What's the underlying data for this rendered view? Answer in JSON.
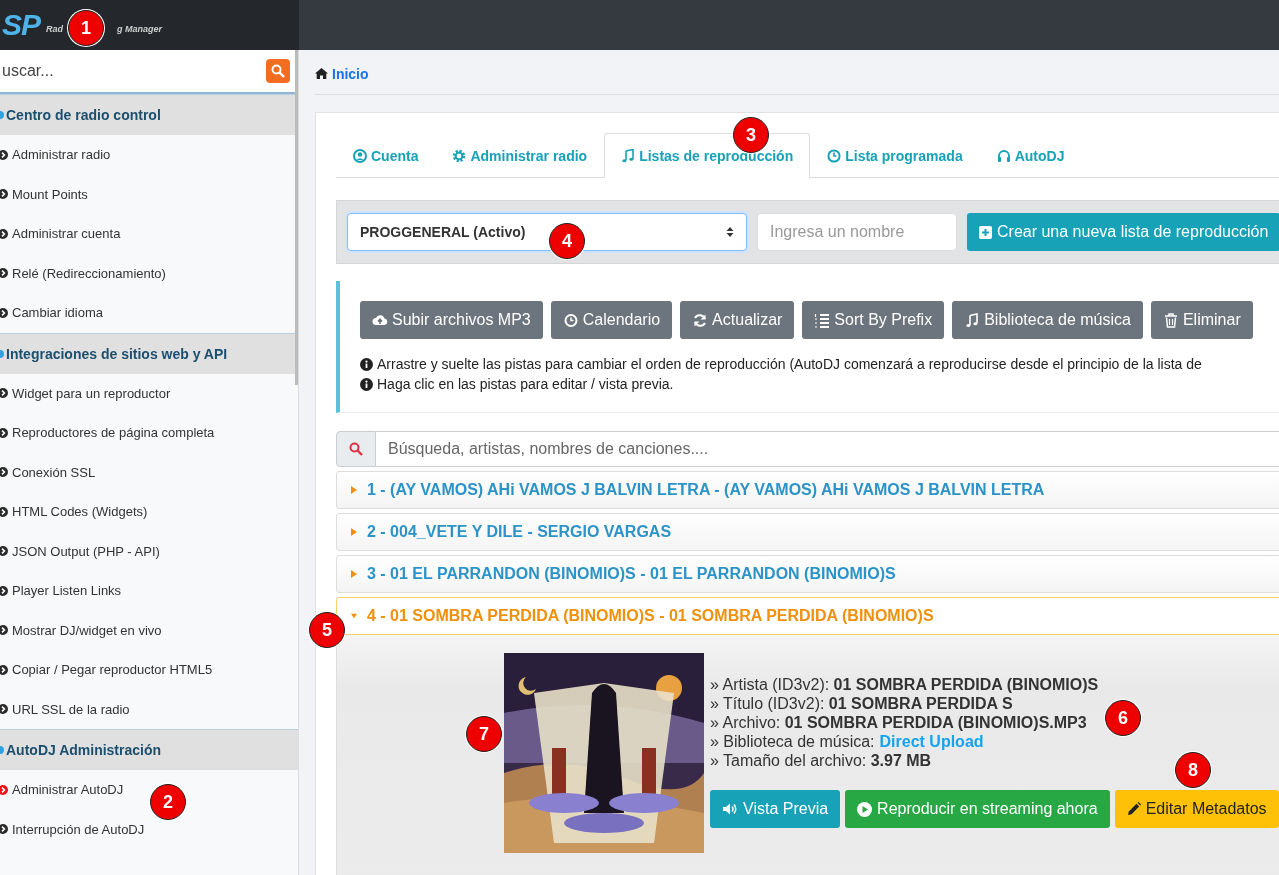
{
  "logo": {
    "mark": "SP",
    "subtitle_parts": [
      "Rad",
      "g Manager"
    ]
  },
  "sidebar": {
    "search": {
      "placeholder": "uscar..."
    },
    "sections": [
      {
        "title": "Centro de radio control",
        "items": [
          {
            "label": "Administrar radio",
            "selected": false
          },
          {
            "label": "Mount Points",
            "selected": false
          },
          {
            "label": "Administrar cuenta",
            "selected": false
          },
          {
            "label": "Relé (Redireccionamiento)",
            "selected": false
          },
          {
            "label": "Cambiar idioma",
            "selected": false
          }
        ]
      },
      {
        "title": "Integraciones de sitios web y API",
        "items": [
          {
            "label": "Widget para un reproductor",
            "selected": false
          },
          {
            "label": "Reproductores de página completa",
            "selected": false
          },
          {
            "label": "Conexión SSL",
            "selected": false
          },
          {
            "label": "HTML Codes (Widgets)",
            "selected": false
          },
          {
            "label": "JSON Output (PHP - API)",
            "selected": false
          },
          {
            "label": "Player Listen Links",
            "selected": false
          },
          {
            "label": "Mostrar DJ/widget en vivo",
            "selected": false
          },
          {
            "label": "Copiar / Pegar reproductor HTML5",
            "selected": false
          },
          {
            "label": "URL SSL de la radio",
            "selected": false
          }
        ]
      },
      {
        "title": "AutoDJ Administración",
        "items": [
          {
            "label": "Administrar AutoDJ",
            "selected": true
          },
          {
            "label": "Interrupción de AutoDJ",
            "selected": false
          }
        ]
      }
    ]
  },
  "breadcrumb": "Inicio",
  "tabs": [
    {
      "label": "Cuenta",
      "selected": false
    },
    {
      "label": "Administrar radio",
      "selected": false
    },
    {
      "label": "Listas de reproducción",
      "selected": true
    },
    {
      "label": "Lista programada",
      "selected": false
    },
    {
      "label": "AutoDJ",
      "selected": false
    }
  ],
  "playlist_select": {
    "value": "PROGGENERAL (Activo)"
  },
  "name_field": {
    "placeholder": "Ingresa un nombre"
  },
  "create_button": "Crear una nueva lista de reproducción",
  "toolbar": [
    "Subir archivos MP3",
    "Calendario",
    "Actualizar",
    "Sort By Prefix",
    "Biblioteca de música",
    "Eliminar"
  ],
  "notes": [
    "Arrastre y suelte las pistas para cambiar el orden de reproducción (AutoDJ comenzará a reproducirse desde el principio de la lista de",
    "Haga clic en las pistas para editar / vista previa."
  ],
  "track_search": {
    "placeholder": "Búsqueda, artistas, nombres de canciones...."
  },
  "tracks": [
    {
      "title": "1 - (AY VAMOS) AHi VAMOS J BALVIN LETRA - (AY VAMOS) AHi VAMOS J BALVIN LETRA",
      "expanded": false
    },
    {
      "title": "2 - 004_VETE Y DILE - SERGIO VARGAS",
      "expanded": false
    },
    {
      "title": "3 - 01 EL PARRANDON (BINOMIO)S - 01 EL PARRANDON (BINOMIO)S",
      "expanded": false
    },
    {
      "title": "4 - 01 SOMBRA PERDIDA (BINOMIO)S - 01 SOMBRA PERDIDA (BINOMIO)S",
      "expanded": true
    }
  ],
  "track_details": {
    "lines": [
      {
        "text": "» Artista (ID3v2): **01 SOMBRA PERDIDA (BINOMIO)S**"
      },
      {
        "text": "» Título (ID3v2): **01 SOMBRA PERDIDA S**"
      },
      {
        "text": "» Archivo: **01 SOMBRA PERDIDA (BINOMIO)S.MP3**"
      },
      {
        "text": "» Biblioteca de música:",
        "link": "Direct Upload"
      },
      {
        "text": "» Tamaño del archivo: **3.97 MB**"
      }
    ],
    "buttons": [
      {
        "label": "Vista Previa",
        "kind": "preview"
      },
      {
        "label": "Reproducir en streaming ahora",
        "kind": "stream"
      },
      {
        "label": "Editar Metadatos",
        "kind": "edit"
      }
    ]
  },
  "markers": [
    "1",
    "2",
    "3",
    "4",
    "5",
    "6",
    "7",
    "8"
  ]
}
